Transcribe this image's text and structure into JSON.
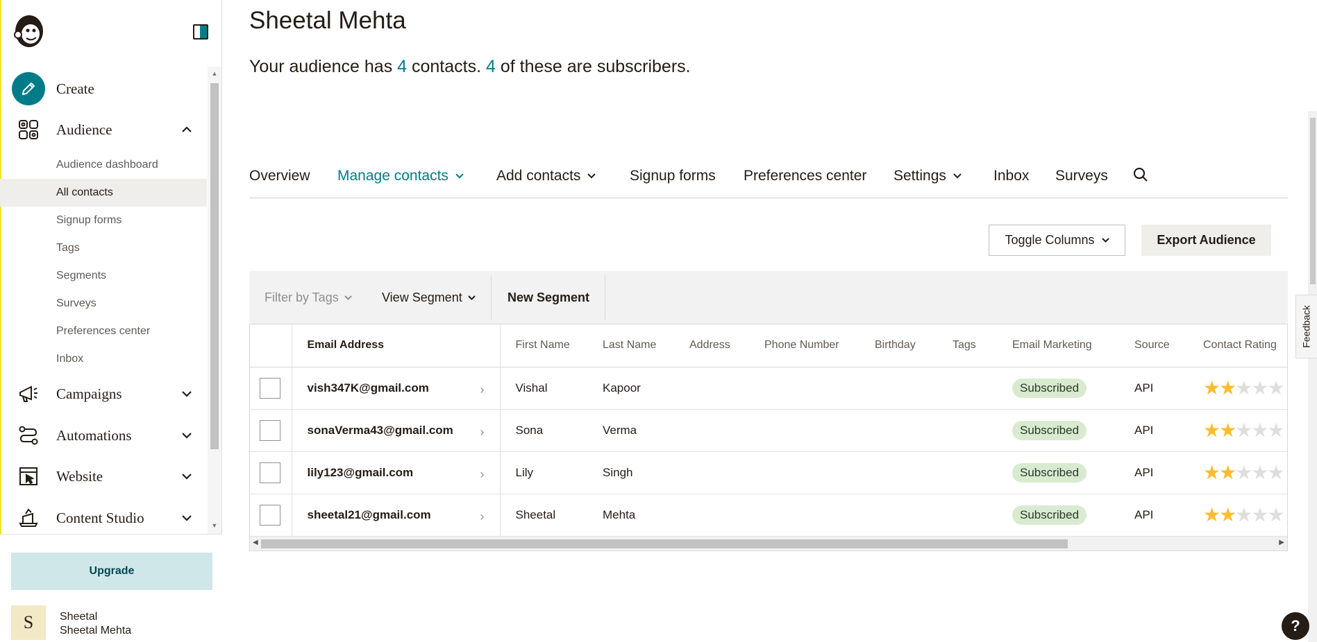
{
  "sidebar": {
    "create_label": "Create",
    "audience_label": "Audience",
    "audience_sub": [
      "Audience dashboard",
      "All contacts",
      "Signup forms",
      "Tags",
      "Segments",
      "Surveys",
      "Preferences center",
      "Inbox"
    ],
    "active_sub": "All contacts",
    "campaigns_label": "Campaigns",
    "automations_label": "Automations",
    "website_label": "Website",
    "content_studio_label": "Content Studio",
    "upgrade_label": "Upgrade",
    "avatar_letter": "S",
    "user_name": "Sheetal",
    "user_full_name": "Sheetal Mehta"
  },
  "header": {
    "title": "Sheetal Mehta",
    "summary_prefix": "Your audience has ",
    "contacts_count": "4",
    "summary_middle": " contacts. ",
    "subscribers_count": "4",
    "summary_suffix": " of these are subscribers."
  },
  "tabs": {
    "overview": "Overview",
    "manage_contacts": "Manage contacts",
    "add_contacts": "Add contacts",
    "signup_forms": "Signup forms",
    "preferences_center": "Preferences center",
    "settings": "Settings",
    "inbox": "Inbox",
    "surveys": "Surveys"
  },
  "actions": {
    "toggle_columns": "Toggle Columns",
    "export_audience": "Export Audience"
  },
  "filters": {
    "filter_by_tags": "Filter by Tags",
    "view_segment": "View Segment",
    "new_segment": "New Segment"
  },
  "table": {
    "headers": {
      "email": "Email Address",
      "first_name": "First Name",
      "last_name": "Last Name",
      "address": "Address",
      "phone": "Phone Number",
      "birthday": "Birthday",
      "tags": "Tags",
      "email_marketing": "Email Marketing",
      "source": "Source",
      "contact_rating": "Contact Rating"
    },
    "rows": [
      {
        "email": "vish347K@gmail.com",
        "first_name": "Vishal",
        "last_name": "Kapoor",
        "status": "Subscribed",
        "source": "API",
        "rating": 2
      },
      {
        "email": "sonaVerma43@gmail.com",
        "first_name": "Sona",
        "last_name": "Verma",
        "status": "Subscribed",
        "source": "API",
        "rating": 2
      },
      {
        "email": "lily123@gmail.com",
        "first_name": "Lily",
        "last_name": "Singh",
        "status": "Subscribed",
        "source": "API",
        "rating": 2
      },
      {
        "email": "sheetal21@gmail.com",
        "first_name": "Sheetal",
        "last_name": "Mehta",
        "status": "Subscribed",
        "source": "API",
        "rating": 2
      }
    ]
  },
  "feedback_label": "Feedback",
  "help_label": "?",
  "colors": {
    "accent": "#007c89",
    "subscribed_bg": "#d8ebd0",
    "star": "#fbbc2e"
  }
}
